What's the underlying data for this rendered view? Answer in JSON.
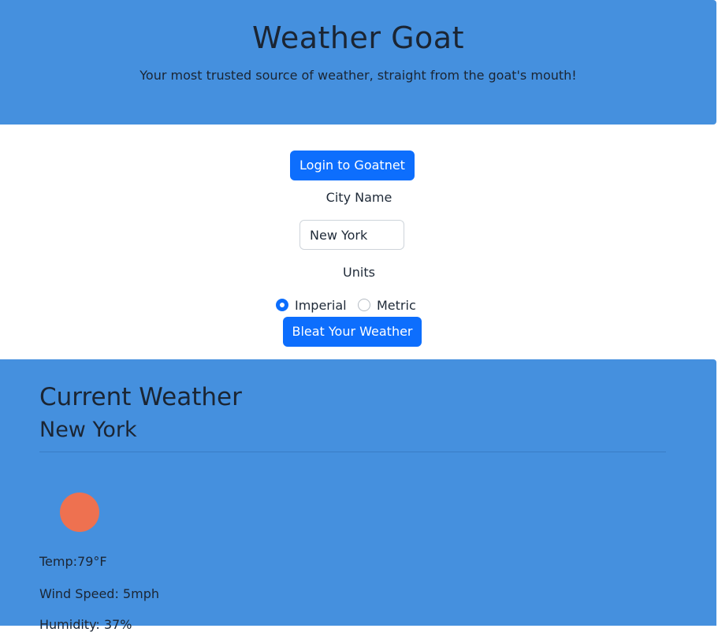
{
  "header": {
    "title": "Weather Goat",
    "subtitle": "Your most trusted source of weather, straight from the goat's mouth!",
    "background_color": "#4590de"
  },
  "form": {
    "login_button_label": "Login to Goatnet",
    "city_label": "City Name",
    "city_value": "New York",
    "units_label": "Units",
    "units_options": [
      {
        "label": "Imperial",
        "checked": true
      },
      {
        "label": "Metric",
        "checked": false
      }
    ],
    "submit_button_label": "Bleat Your Weather",
    "button_color": "#0d6efd"
  },
  "weather": {
    "heading": "Current Weather",
    "city": "New York",
    "icon": "sun-icon",
    "icon_color": "#ee7150",
    "temp": "Temp:79°F",
    "wind_speed": "Wind Speed: 5mph",
    "humidity": "Humidity: 37%"
  }
}
